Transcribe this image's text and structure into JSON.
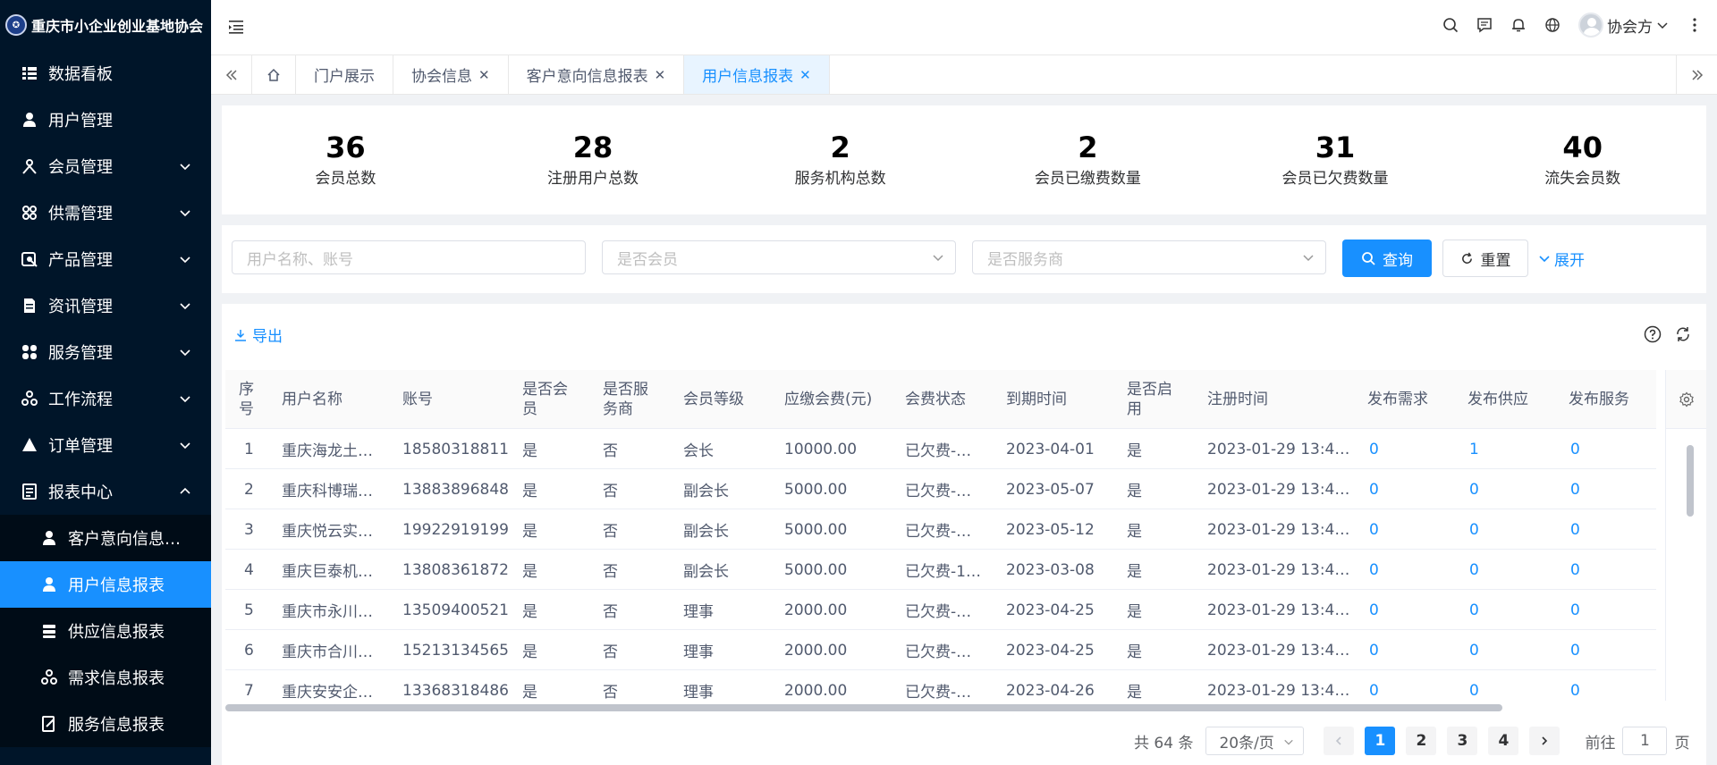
{
  "app": {
    "title": "重庆市小企业创业基地协会"
  },
  "sidebar": {
    "items": [
      {
        "label": "数据看板",
        "icon": "dashboard-icon"
      },
      {
        "label": "用户管理",
        "icon": "user-icon"
      },
      {
        "label": "会员管理",
        "icon": "member-icon"
      },
      {
        "label": "供需管理",
        "icon": "apps-icon"
      },
      {
        "label": "产品管理",
        "icon": "product-icon"
      },
      {
        "label": "资讯管理",
        "icon": "document-icon"
      },
      {
        "label": "服务管理",
        "icon": "service-icon"
      },
      {
        "label": "工作流程",
        "icon": "workflow-icon"
      },
      {
        "label": "订单管理",
        "icon": "order-icon"
      },
      {
        "label": "报表中心",
        "icon": "report-icon"
      }
    ],
    "sub_items": [
      {
        "label": "客户意向信息…"
      },
      {
        "label": "用户信息报表"
      },
      {
        "label": "供应信息报表"
      },
      {
        "label": "需求信息报表"
      },
      {
        "label": "服务信息报表"
      }
    ]
  },
  "header": {
    "username": "协会方"
  },
  "tabs": [
    {
      "label": "门户展示",
      "closable": false
    },
    {
      "label": "协会信息",
      "closable": true
    },
    {
      "label": "客户意向信息报表",
      "closable": true
    },
    {
      "label": "用户信息报表",
      "closable": true,
      "active": true
    }
  ],
  "stats": [
    {
      "value": "36",
      "label": "会员总数"
    },
    {
      "value": "28",
      "label": "注册用户总数"
    },
    {
      "value": "2",
      "label": "服务机构总数"
    },
    {
      "value": "2",
      "label": "会员已缴费数量"
    },
    {
      "value": "31",
      "label": "会员已欠费数量"
    },
    {
      "value": "40",
      "label": "流失会员数"
    }
  ],
  "search": {
    "name_placeholder": "用户名称、账号",
    "member_placeholder": "是否会员",
    "provider_placeholder": "是否服务商",
    "query_label": "查询",
    "reset_label": "重置",
    "expand_label": "展开"
  },
  "table": {
    "export_label": "导出",
    "headers": {
      "seq": "序号",
      "name": "用户名称",
      "account": "账号",
      "is_member": "是否会员",
      "is_provider": "是否服务商",
      "level": "会员等级",
      "fee": "应缴会费(元)",
      "fee_status": "会费状态",
      "expire": "到期时间",
      "enabled": "是否启用",
      "reg_time": "注册时间",
      "demand": "发布需求",
      "supply": "发布供应",
      "service": "发布服务"
    },
    "rows": [
      {
        "seq": "1",
        "name": "重庆海龙土…",
        "account": "18580318811",
        "is_member": "是",
        "is_provider": "否",
        "level": "会长",
        "fee": "10000.00",
        "fee_status": "已欠费-…",
        "expire": "2023-04-01",
        "enabled": "是",
        "reg_time": "2023-01-29 13:4…",
        "demand": "0",
        "supply": "1",
        "service": "0"
      },
      {
        "seq": "2",
        "name": "重庆科博瑞…",
        "account": "13883896848",
        "is_member": "是",
        "is_provider": "否",
        "level": "副会长",
        "fee": "5000.00",
        "fee_status": "已欠费-…",
        "expire": "2023-05-07",
        "enabled": "是",
        "reg_time": "2023-01-29 13:4…",
        "demand": "0",
        "supply": "0",
        "service": "0"
      },
      {
        "seq": "3",
        "name": "重庆悦云实…",
        "account": "19922919199",
        "is_member": "是",
        "is_provider": "否",
        "level": "副会长",
        "fee": "5000.00",
        "fee_status": "已欠费-…",
        "expire": "2023-05-12",
        "enabled": "是",
        "reg_time": "2023-01-29 13:4…",
        "demand": "0",
        "supply": "0",
        "service": "0"
      },
      {
        "seq": "4",
        "name": "重庆巨泰机…",
        "account": "13808361872",
        "is_member": "是",
        "is_provider": "否",
        "level": "副会长",
        "fee": "5000.00",
        "fee_status": "已欠费-1…",
        "expire": "2023-03-08",
        "enabled": "是",
        "reg_time": "2023-01-29 13:4…",
        "demand": "0",
        "supply": "0",
        "service": "0"
      },
      {
        "seq": "5",
        "name": "重庆市永川…",
        "account": "13509400521",
        "is_member": "是",
        "is_provider": "否",
        "level": "理事",
        "fee": "2000.00",
        "fee_status": "已欠费-…",
        "expire": "2023-04-25",
        "enabled": "是",
        "reg_time": "2023-01-29 13:4…",
        "demand": "0",
        "supply": "0",
        "service": "0"
      },
      {
        "seq": "6",
        "name": "重庆市合川…",
        "account": "15213134565",
        "is_member": "是",
        "is_provider": "否",
        "level": "理事",
        "fee": "2000.00",
        "fee_status": "已欠费-…",
        "expire": "2023-04-25",
        "enabled": "是",
        "reg_time": "2023-01-29 13:4…",
        "demand": "0",
        "supply": "0",
        "service": "0"
      },
      {
        "seq": "7",
        "name": "重庆安安企…",
        "account": "13368318486",
        "is_member": "是",
        "is_provider": "否",
        "level": "理事",
        "fee": "2000.00",
        "fee_status": "已欠费-…",
        "expire": "2023-04-26",
        "enabled": "是",
        "reg_time": "2023-01-29 13:4…",
        "demand": "0",
        "supply": "0",
        "service": "0"
      }
    ]
  },
  "pagination": {
    "total_text": "共 64 条",
    "page_size": "20条/页",
    "pages": [
      "1",
      "2",
      "3",
      "4"
    ],
    "current": "1",
    "goto_label": "前往",
    "goto_value": "1",
    "page_unit": "页"
  },
  "colors": {
    "sidebar_bg": "#001529",
    "accent": "#1890ff"
  }
}
